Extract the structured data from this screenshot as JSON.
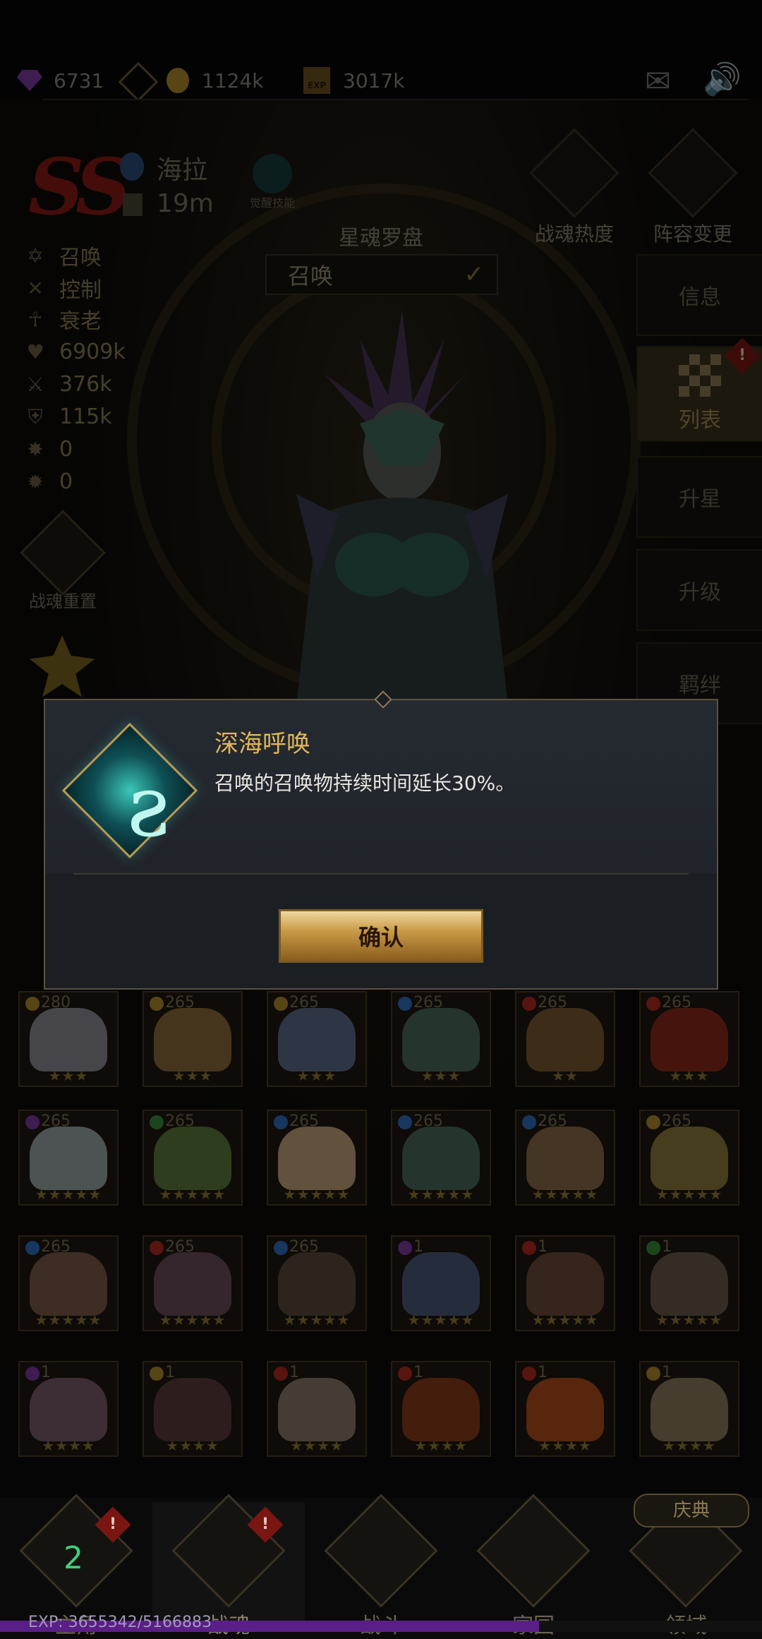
{
  "resources": {
    "gems": "6731",
    "gold": "1124k",
    "exp_label": "EXP",
    "exp": "3017k"
  },
  "hero": {
    "grade": "SS",
    "name": "海拉",
    "distance": "19m",
    "awaken_skill_label": "觉醒技能",
    "stats": [
      {
        "icon": "summon-icon",
        "value": "召唤"
      },
      {
        "icon": "control-icon",
        "value": "控制"
      },
      {
        "icon": "decay-icon",
        "value": "衰老"
      },
      {
        "icon": "heart-icon",
        "value": "6909k"
      },
      {
        "icon": "sword-icon",
        "value": "376k"
      },
      {
        "icon": "shield-icon",
        "value": "115k"
      },
      {
        "icon": "crit-icon",
        "value": "0"
      },
      {
        "icon": "dodge-icon",
        "value": "0"
      }
    ],
    "reset_label": "战魂重置"
  },
  "compass": {
    "title": "星魂罗盘",
    "selected": "召唤"
  },
  "right_buttons": {
    "heat": "战魂热度",
    "lineup": "阵容变更"
  },
  "side_tabs": [
    "信息",
    "列表",
    "升星",
    "升级",
    "羁绊"
  ],
  "side_badge": "!",
  "cards": {
    "row1": [
      {
        "lvl": "280",
        "el": "#b08a2c",
        "stars": "★★★",
        "face": "#8c8c94"
      },
      {
        "lvl": "265",
        "el": "#b08a2c",
        "stars": "★★★",
        "face": "#8a6a3a"
      },
      {
        "lvl": "265",
        "el": "#b08a2c",
        "stars": "★★★",
        "face": "#5d6c8c"
      },
      {
        "lvl": "265",
        "el": "#2f6fbf",
        "stars": "★★★",
        "face": "#4a6a5a"
      },
      {
        "lvl": "265",
        "el": "#b02a20",
        "stars": "★★",
        "face": "#7a5a30"
      },
      {
        "lvl": "265",
        "el": "#b02a20",
        "stars": "★★★",
        "face": "#8a2a1a"
      }
    ],
    "row2": [
      {
        "lvl": "265",
        "el": "#7c3aa3",
        "stars": "★★★★★",
        "face": "#9aa6a6"
      },
      {
        "lvl": "265",
        "el": "#3a8a3a",
        "stars": "★★★★★",
        "face": "#5a7a3a"
      },
      {
        "lvl": "265",
        "el": "#2f6fbf",
        "stars": "★★★★★",
        "face": "#c2a27a"
      },
      {
        "lvl": "265",
        "el": "#2f6fbf",
        "stars": "★★★★★",
        "face": "#4a6a5a"
      },
      {
        "lvl": "265",
        "el": "#2f6fbf",
        "stars": "★★★★★",
        "face": "#8a6a4a"
      },
      {
        "lvl": "265",
        "el": "#b08a2c",
        "stars": "★★★★★",
        "face": "#8a7a3a"
      }
    ],
    "row3": [
      {
        "lvl": "265",
        "el": "#2f6fbf",
        "stars": "★★★★★",
        "face": "#7a5a4a"
      },
      {
        "lvl": "265",
        "el": "#b02a20",
        "stars": "★★★★★",
        "face": "#6a4a5a"
      },
      {
        "lvl": "265",
        "el": "#2f6fbf",
        "stars": "★★★★★",
        "face": "#5a4a3a"
      },
      {
        "lvl": "1",
        "el": "#7c3aa3",
        "stars": "★★★★★",
        "face": "#4a5a7a"
      },
      {
        "lvl": "1",
        "el": "#b02a20",
        "stars": "★★★★★",
        "face": "#6a4a3a"
      },
      {
        "lvl": "1",
        "el": "#3a8a3a",
        "stars": "★★★★★",
        "face": "#6a5a4a"
      }
    ],
    "row4": [
      {
        "lvl": "1",
        "el": "#7c3aa3",
        "stars": "★★★★",
        "face": "#7a5a6a"
      },
      {
        "lvl": "1",
        "el": "#b08a2c",
        "stars": "★★★★",
        "face": "#5a3a3a"
      },
      {
        "lvl": "1",
        "el": "#b02a20",
        "stars": "★★★★",
        "face": "#8a7a6a"
      },
      {
        "lvl": "1",
        "el": "#b02a20",
        "stars": "★★★★",
        "face": "#8a3a1a"
      },
      {
        "lvl": "1",
        "el": "#b02a20",
        "stars": "★★★★",
        "face": "#b04a1a"
      },
      {
        "lvl": "1",
        "el": "#b08a2c",
        "stars": "★★★★",
        "face": "#8a7a5a"
      }
    ]
  },
  "modal": {
    "skill_title": "深海呼唤",
    "skill_desc": "召唤的召唤物持续时间延长30%。",
    "confirm_label": "确认"
  },
  "nav": {
    "items": [
      {
        "label": "主角",
        "badge": "!",
        "level": "2"
      },
      {
        "label": "战魂",
        "badge": "!"
      },
      {
        "label": "战斗"
      },
      {
        "label": "家园"
      },
      {
        "label": "领域"
      }
    ],
    "festival": "庆典",
    "exp_text": "EXP: 3655342/5166883",
    "exp_current": 3655342,
    "exp_max": 5166883
  }
}
